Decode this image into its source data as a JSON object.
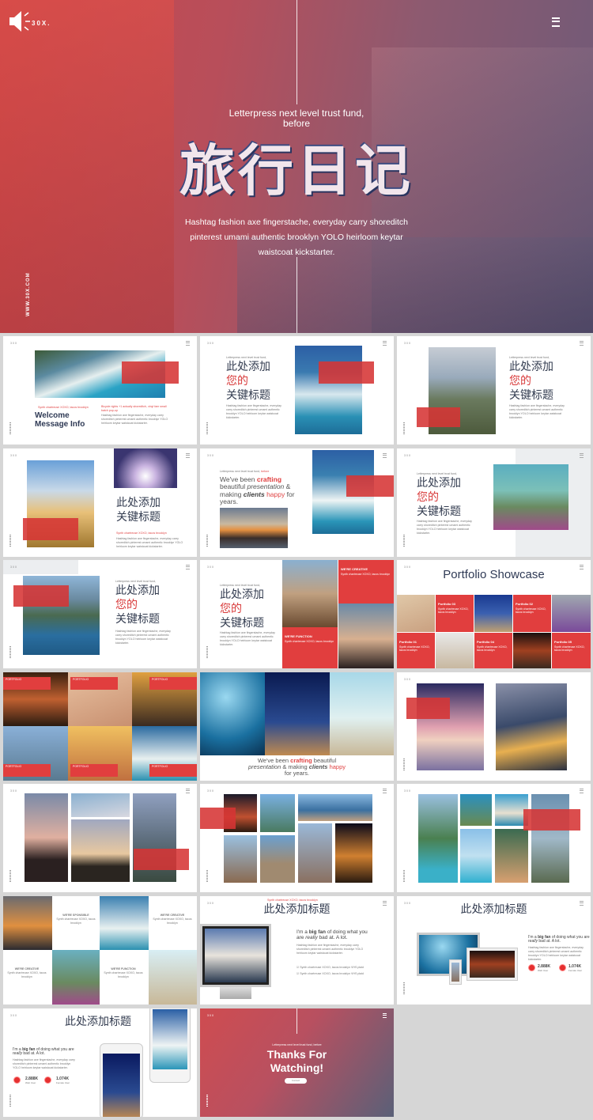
{
  "hero": {
    "logo": "30X.",
    "tagline": "Letterpress next level trust fund, before",
    "title": "旅行日记",
    "body": "Hashtag fashion axe fingerstache, everyday carry shoreditch pinterest umami authentic brooklyn YOLO heirloom keytar waistcoat kickstarter.",
    "side_url": "WWW.30X.COM",
    "icons": {
      "left": "speaker-icon",
      "right": "menu-icon"
    }
  },
  "common": {
    "logo": "30X",
    "tagline": "Letterpress next level trust fund,",
    "small_red": "Synth chartreuse XOXO, tacos brooklyn",
    "body": "Hashtag fashion axe fingerstache, everyday carry shoreditch pinterest umami authentic brooklyn YOLO heirloom keytar waistcoat kickstarter.",
    "cn_line1": "此处添加",
    "cn_line2": "您的",
    "cn_line3": "关键标题",
    "cn_title": "此处添加标题"
  },
  "welcome": {
    "title_line1": "Welcome",
    "title_line2": "Message Info",
    "red_right": "Bicycle rights +1 actually shoreditch, vinyl fam small batch pop-up"
  },
  "crafting": {
    "part1": "We've been ",
    "crafting": "crafting",
    "part2": " beautiful ",
    "presentation": "presentation",
    "part3": " & making ",
    "clients": "clients",
    "happy": "happy",
    "part4": " for years.",
    "tag_red": "before"
  },
  "grid_tiles": {
    "creative": "WE'RE CREATIVE",
    "function": "WE'RE FUNCTION"
  },
  "portfolio": {
    "title": "Portfolio Showcase",
    "items": [
      "Portfolio 03",
      "Portfolio 02",
      "Portfolio 01",
      "Portfolio 04",
      "Portfolio 05"
    ]
  },
  "collage_labels": [
    "PORTFOLIO",
    "PORTFOLIO",
    "PORTFOLIO",
    "PORTFOLIO",
    "PORTFOLIO",
    "PORTFOLIO"
  ],
  "features": [
    "WE'RE SPONSIBLE",
    "WE'RE CREATIVE",
    "WE'RE CREATIVE",
    "WE'RE FUNCTION"
  ],
  "bigfan": {
    "part1": "I'm a ",
    "big_fan": "big fan",
    "part2": " of doing what you are ",
    "really": "really",
    "part3": " bad at. A lot.",
    "check_items": [
      "Synth chartreuse XOXO, tacos brooklyn VHS plaid",
      "Synth chartreuse XOXO, tacos brooklyn VHS plaid"
    ]
  },
  "stats": [
    {
      "value": "2.888K",
      "label": "Web User"
    },
    {
      "value": "1.074K",
      "label": "Female User"
    }
  ],
  "thanks": {
    "tagline": "Letterpress next level trust fund, before",
    "line1": "Thanks For",
    "line2": "Watching!",
    "button": "Contact"
  },
  "colors": {
    "accent": "#d9393e",
    "dark_text": "#2f3a55",
    "hero_start": "#c9474b",
    "hero_end": "#6e5a78"
  }
}
